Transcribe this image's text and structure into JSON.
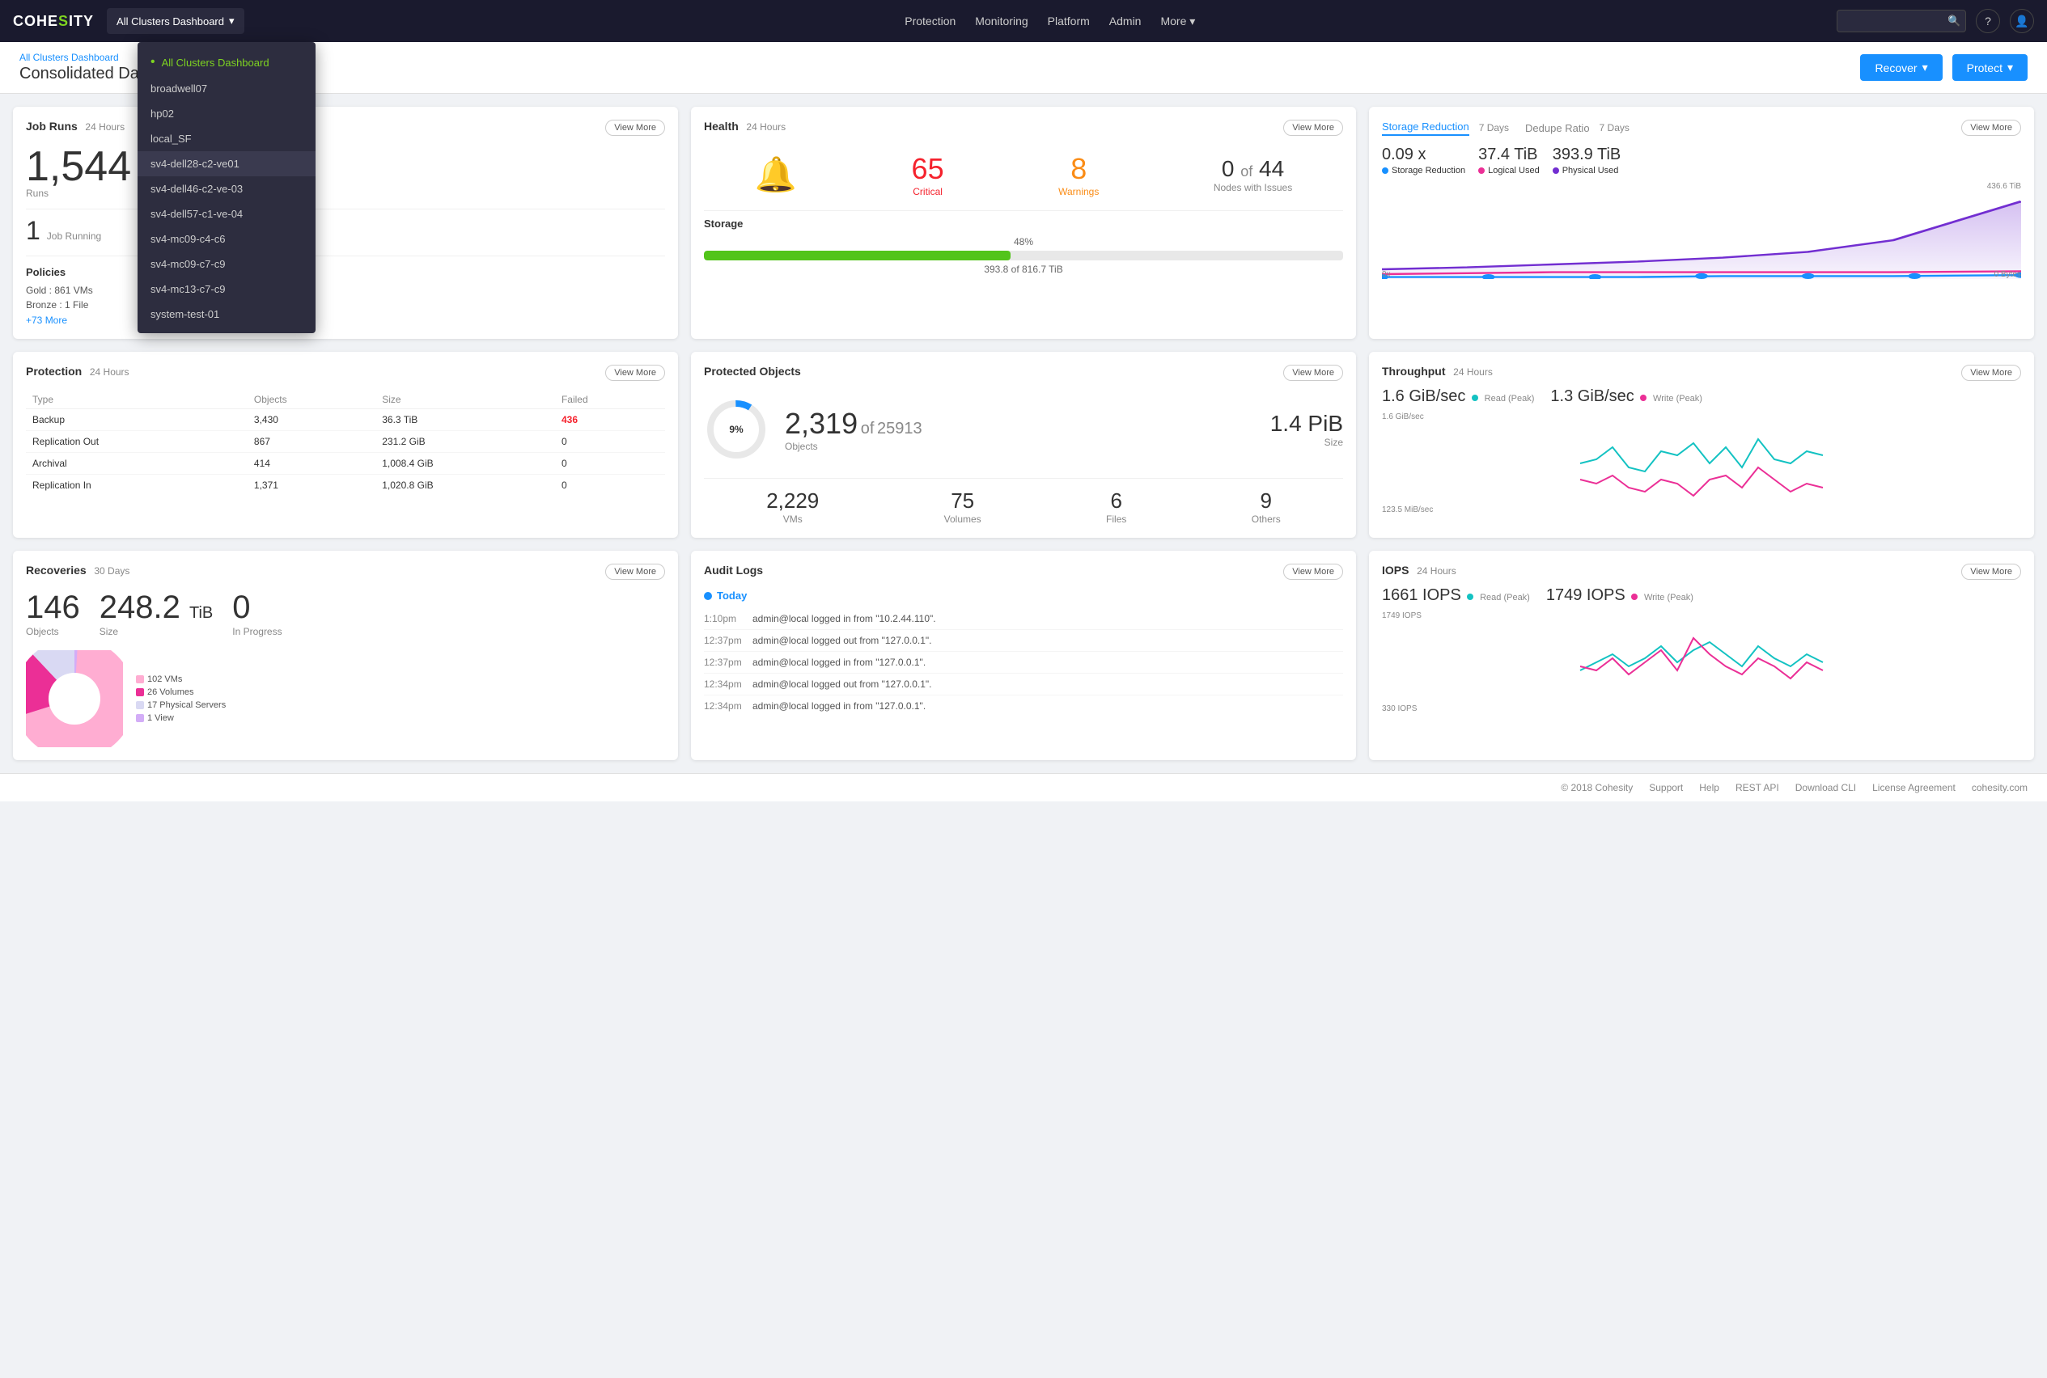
{
  "brand": {
    "name_part1": "COHE",
    "name_part2": "SITY"
  },
  "topnav": {
    "cluster_dropdown_label": "All Clusters Dashboard",
    "nav_items": [
      "Protection",
      "Monitoring",
      "Platform",
      "Admin",
      "More"
    ],
    "search_placeholder": ""
  },
  "cluster_menu": {
    "items": [
      {
        "label": "All Clusters Dashboard",
        "active": true
      },
      {
        "label": "broadwell07",
        "active": false
      },
      {
        "label": "hp02",
        "active": false
      },
      {
        "label": "local_SF",
        "active": false
      },
      {
        "label": "sv4-dell28-c2-ve01",
        "active": false,
        "highlighted": true
      },
      {
        "label": "sv4-dell46-c2-ve-03",
        "active": false
      },
      {
        "label": "sv4-dell57-c1-ve-04",
        "active": false
      },
      {
        "label": "sv4-mc09-c4-c6",
        "active": false
      },
      {
        "label": "sv4-mc09-c7-c9",
        "active": false
      },
      {
        "label": "sv4-mc13-c7-c9",
        "active": false
      },
      {
        "label": "system-test-01",
        "active": false
      }
    ]
  },
  "page": {
    "title": "Consolidated Dashboard (All Clusters)",
    "recover_label": "Recover",
    "protect_label": "Protect"
  },
  "job_runs": {
    "title": "Job Runs",
    "subtitle": "24 Hours",
    "runs_num": "1,544",
    "runs_label": "Runs",
    "running_num": "1",
    "running_label": "Job Running",
    "view_more": "View More",
    "policies_title": "Policies",
    "gold_label": "Gold :",
    "gold_value": "861 VMs",
    "bronze_label": "Bronze :",
    "bronze_value": "1 File",
    "more_policies": "+73 More"
  },
  "health": {
    "title": "Health",
    "subtitle": "24 Hours",
    "view_more": "View More",
    "critical_num": "65",
    "critical_label": "Critical",
    "warning_num": "8",
    "warning_label": "Warnings",
    "nodes_num": "0",
    "nodes_of": "of",
    "nodes_total": "44",
    "nodes_label": "Nodes with Issues",
    "storage_title": "Storage",
    "storage_pct": "48%",
    "storage_used": "393.8 of 816.7 TiB"
  },
  "storage_reduction": {
    "tab_active": "Storage Reduction",
    "tab_days": "7 Days",
    "tab2": "Dedupe Ratio",
    "tab2_days": "7 Days",
    "view_more": "View More",
    "metric1_val": "0.09 x",
    "metric1_label": "Storage Reduction",
    "metric1_color": "#1890ff",
    "metric2_val": "37.4 TiB",
    "metric2_label": "Logical Used",
    "metric2_color": "#eb2f96",
    "metric3_val": "393.9 TiB",
    "metric3_label": "Physical Used",
    "metric3_color": "#722ed1",
    "chart_ymax": "436.6 TiB",
    "chart_ymin": "0 Bytes",
    "chart_xmin": "0x"
  },
  "protection": {
    "title": "Protection",
    "subtitle": "24 Hours",
    "view_more": "View More",
    "columns": [
      "Type",
      "Objects",
      "Size",
      "Failed"
    ],
    "rows": [
      {
        "type": "Backup",
        "objects": "3,430",
        "size": "36.3 TiB",
        "failed": "436",
        "failed_red": true
      },
      {
        "type": "Replication Out",
        "objects": "867",
        "size": "231.2 GiB",
        "failed": "0",
        "failed_red": false
      },
      {
        "type": "Archival",
        "objects": "414",
        "size": "1,008.4 GiB",
        "failed": "0",
        "failed_red": false
      },
      {
        "type": "Replication In",
        "objects": "1,371",
        "size": "1,020.8 GiB",
        "failed": "0",
        "failed_red": false
      }
    ]
  },
  "protected_objects": {
    "title": "Protected Objects",
    "view_more": "View More",
    "pct": "9%",
    "count": "2,319",
    "of_label": "of",
    "total": "25913",
    "objects_label": "Objects",
    "size": "1.4 PiB",
    "size_label": "Size",
    "breakdown": [
      {
        "num": "2,229",
        "label": "VMs"
      },
      {
        "num": "75",
        "label": "Volumes"
      },
      {
        "num": "6",
        "label": "Files"
      },
      {
        "num": "9",
        "label": "Others"
      }
    ]
  },
  "throughput": {
    "title": "Throughput",
    "subtitle": "24 Hours",
    "view_more": "View More",
    "read_val": "1.6 GiB/sec",
    "read_label": "Read (Peak)",
    "read_color": "#13c2c2",
    "write_val": "1.3 GiB/sec",
    "write_label": "Write (Peak)",
    "write_color": "#eb2f96",
    "chart_ymax": "1.6 GiB/sec",
    "chart_ymin": "123.5 MiB/sec"
  },
  "recoveries": {
    "title": "Recoveries",
    "subtitle": "30 Days",
    "view_more": "View More",
    "objects_num": "146",
    "objects_label": "Objects",
    "size_num": "248.2",
    "size_unit": "TiB",
    "size_label": "Size",
    "in_progress_num": "0",
    "in_progress_label": "In Progress",
    "pie_labels": [
      {
        "label": "102 VMs",
        "color": "#ffadd2"
      },
      {
        "label": "26 Volumes",
        "color": "#eb2f96"
      },
      {
        "label": "17 Physical Servers",
        "color": "#f9f0ff"
      },
      {
        "label": "1 View",
        "color": "#d3adf7"
      }
    ]
  },
  "audit_logs": {
    "title": "Audit Logs",
    "view_more": "View More",
    "today_label": "Today",
    "entries": [
      {
        "time": "1:10pm",
        "msg": "admin@local logged in from \"10.2.44.110\"."
      },
      {
        "time": "12:37pm",
        "msg": "admin@local logged out from \"127.0.0.1\"."
      },
      {
        "time": "12:37pm",
        "msg": "admin@local logged in from \"127.0.0.1\"."
      },
      {
        "time": "12:34pm",
        "msg": "admin@local logged out from \"127.0.0.1\"."
      },
      {
        "time": "12:34pm",
        "msg": "admin@local logged in from \"127.0.0.1\"."
      }
    ]
  },
  "iops": {
    "title": "IOPS",
    "subtitle": "24 Hours",
    "view_more": "View More",
    "read_val": "1661 IOPS",
    "read_label": "Read (Peak)",
    "read_color": "#13c2c2",
    "write_val": "1749 IOPS",
    "write_label": "Write (Peak)",
    "write_color": "#eb2f96",
    "chart_ymax": "1749 IOPS",
    "chart_ymin": "330 IOPS"
  },
  "footer": {
    "copyright": "© 2018 Cohesity",
    "links": [
      "Support",
      "Help",
      "REST API",
      "Download CLI",
      "License Agreement",
      "cohesity.com"
    ]
  }
}
